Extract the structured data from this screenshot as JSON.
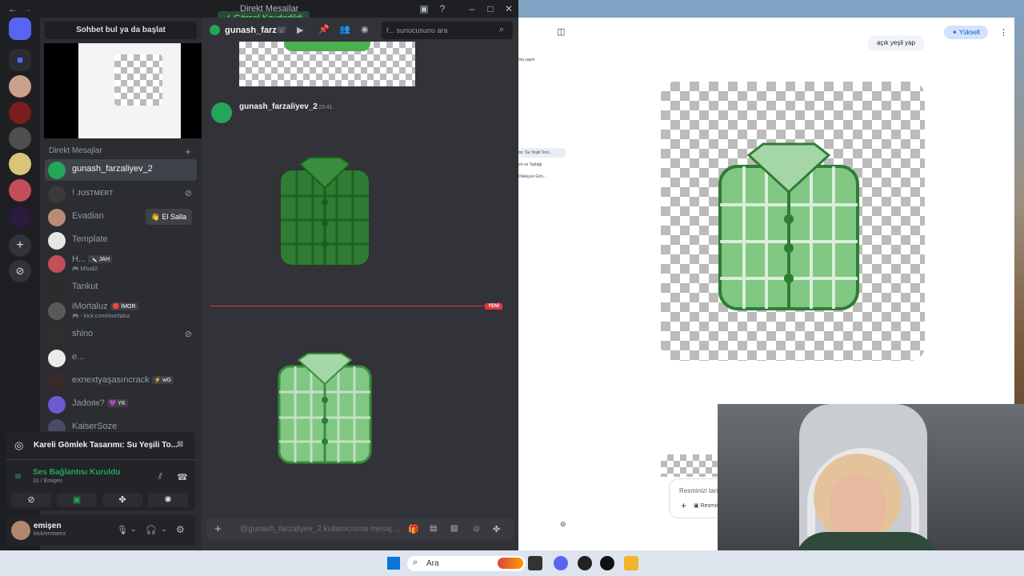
{
  "discord": {
    "window_title": "Direkt Mesajlar",
    "toast": "Görsel Kaydedildi",
    "find_conversation": "Sohbet bul ya da başlat",
    "dm_header": "Direkt Mesajlar",
    "dms": [
      {
        "name": "gunash_farzaliyev_2",
        "active": true
      },
      {
        "name": "! ᴊᴜsᴛᴍᴇʀᴛ"
      },
      {
        "name": "Evadian",
        "action": "👋 El Salla"
      },
      {
        "name": "Template"
      },
      {
        "name": "H...",
        "badge": "🔪 JAH",
        "sub": "🎮 Misali2"
      },
      {
        "name": "Tankut"
      },
      {
        "name": "iMortaluz",
        "badge": "🔴 İMOR",
        "sub": "🎮 - kick.com/imortaluz"
      },
      {
        "name": "shino"
      },
      {
        "name": "e..."
      },
      {
        "name": "exnextyaşasıncrack",
        "badge": "⚡ wG"
      },
      {
        "name": "Jadояк?",
        "badge": "💜 YK"
      },
      {
        "name": "KaiserSoze"
      }
    ],
    "activity_title": "Kareli Gömlek Tasarımı: Su Yeşili To...",
    "voice_status": "Ses Bağlantısı Kuruldu",
    "voice_sub": "31 / Emişen",
    "user_name": "emişen",
    "user_status": "kick/emisenx",
    "chat": {
      "channel_name": "gunash_farz",
      "search_placeholder": "f... sunucusunu ara",
      "author": "gunash_farzaliyev_2",
      "time": "23:41",
      "new_label": "YENİ",
      "composer_placeholder": "@gunash_farzaliyev_2 kullanıcısına mesaj ..."
    }
  },
  "browser": {
    "upgrade": "✦ Yükselt",
    "user_message": "açık yeşil yap",
    "side_items": [
      "ma yapın",
      "mı: Su Yeşili Toni...",
      "eri ve Taslağı",
      "Dilekçesi Gön..."
    ],
    "prompt_placeholder": "Resminizi tarif",
    "tool_label": "Resmini"
  },
  "taskbar": {
    "search": "Ara"
  }
}
